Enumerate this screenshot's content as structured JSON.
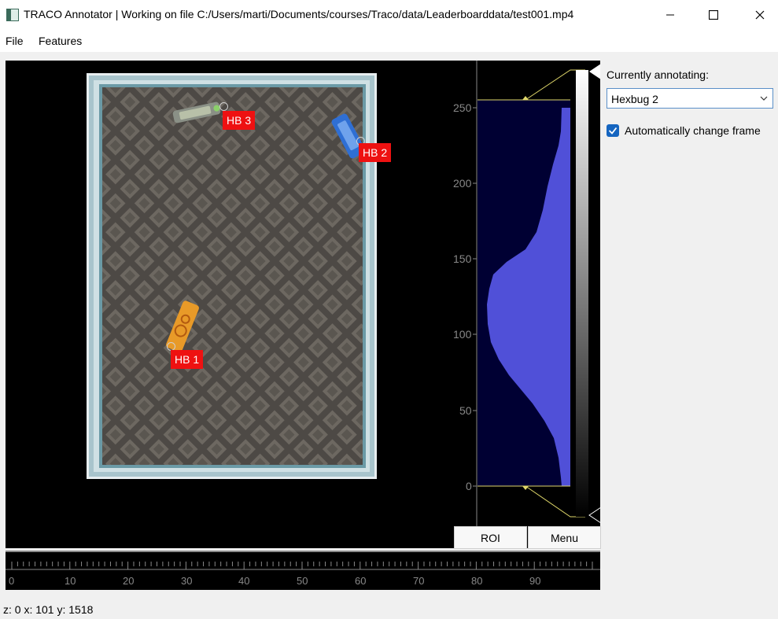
{
  "window": {
    "title": "TRACO Annotator | Working on file C:/Users/marti/Documents/courses/Traco/data/Leaderboarddata/test001.mp4"
  },
  "menu": {
    "file": "File",
    "features": "Features"
  },
  "annotations": [
    {
      "label": "HB 1"
    },
    {
      "label": "HB 2"
    },
    {
      "label": "HB 3"
    }
  ],
  "histogram": {
    "ticks": [
      "250",
      "200",
      "150",
      "100",
      "50",
      "0"
    ],
    "roi_button": "ROI",
    "menu_button": "Menu"
  },
  "timeline": {
    "ticks": [
      "0",
      "10",
      "20",
      "30",
      "40",
      "50",
      "60",
      "70",
      "80",
      "90"
    ]
  },
  "panel": {
    "label": "Currently annotating:",
    "selected": "Hexbug 2",
    "auto_change_label": "Automatically change frame",
    "auto_change_checked": true
  },
  "status": "z: 0 x: 101 y: 1518",
  "colors": {
    "label_bg": "#ee1111",
    "histogram_fill": "#5050d8",
    "histogram_bg": "#000033",
    "accent": "#1565c0"
  }
}
